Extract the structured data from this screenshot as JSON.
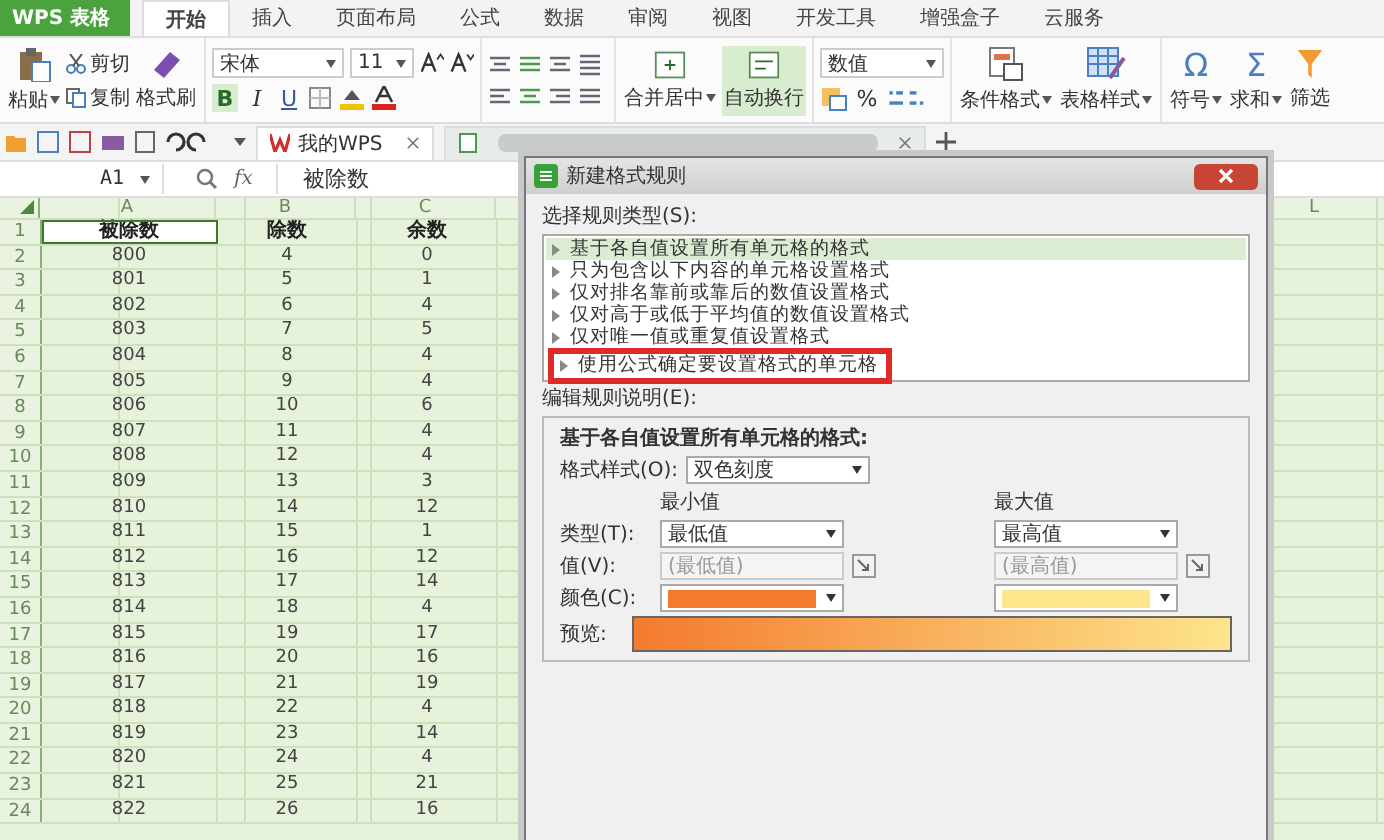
{
  "app_menu": {
    "label": "WPS 表格"
  },
  "tabs": [
    {
      "label": "开始",
      "selected": true
    },
    {
      "label": "插入",
      "selected": false
    },
    {
      "label": "页面布局",
      "selected": false
    },
    {
      "label": "公式",
      "selected": false
    },
    {
      "label": "数据",
      "selected": false
    },
    {
      "label": "审阅",
      "selected": false
    },
    {
      "label": "视图",
      "selected": false
    },
    {
      "label": "开发工具",
      "selected": false
    },
    {
      "label": "增强盒子",
      "selected": false
    },
    {
      "label": "云服务",
      "selected": false
    }
  ],
  "ribbon": {
    "paste": "粘贴",
    "cut": "剪切",
    "copy": "复制",
    "format_painter": "格式刷",
    "font": "宋体",
    "font_size": "11",
    "bold": "B",
    "italic": "I",
    "underline": "U",
    "merge_center": "合并居中",
    "wrap_text": {
      "label": "自动换行",
      "on": true
    },
    "number_format": "数值",
    "percent": "%",
    "conditional_format": "条件格式",
    "table_style": "表格样式",
    "symbol_glyph": "Ω",
    "symbol": "符号",
    "sum_glyph": "Σ",
    "sum": "求和",
    "filter": "筛选"
  },
  "doc_tabs": [
    {
      "label": "我的WPS"
    }
  ],
  "formula_bar": {
    "cell_ref": "A1",
    "fx": "fx",
    "content": "被除数"
  },
  "sheet": {
    "columns": [
      "A",
      "B",
      "C",
      "L"
    ],
    "rows": [
      {
        "num": "1",
        "kind": "header",
        "cells": [
          "被除数",
          "除数",
          "余数"
        ]
      },
      {
        "num": "2",
        "kind": "data",
        "cells": [
          "800",
          "4",
          "0"
        ]
      },
      {
        "num": "3",
        "kind": "data",
        "cells": [
          "801",
          "5",
          "1"
        ]
      },
      {
        "num": "4",
        "kind": "data",
        "cells": [
          "802",
          "6",
          "4"
        ]
      },
      {
        "num": "5",
        "kind": "data",
        "cells": [
          "803",
          "7",
          "5"
        ]
      },
      {
        "num": "6",
        "kind": "data",
        "cells": [
          "804",
          "8",
          "4"
        ]
      },
      {
        "num": "7",
        "kind": "data",
        "cells": [
          "805",
          "9",
          "4"
        ]
      },
      {
        "num": "8",
        "kind": "data",
        "cells": [
          "806",
          "10",
          "6"
        ]
      },
      {
        "num": "9",
        "kind": "data",
        "cells": [
          "807",
          "11",
          "4"
        ]
      },
      {
        "num": "10",
        "kind": "data",
        "cells": [
          "808",
          "12",
          "4"
        ]
      },
      {
        "num": "11",
        "kind": "data",
        "cells": [
          "809",
          "13",
          "3"
        ]
      },
      {
        "num": "12",
        "kind": "data",
        "cells": [
          "810",
          "14",
          "12"
        ]
      },
      {
        "num": "13",
        "kind": "data",
        "cells": [
          "811",
          "15",
          "1"
        ]
      },
      {
        "num": "14",
        "kind": "data",
        "cells": [
          "812",
          "16",
          "12"
        ]
      },
      {
        "num": "15",
        "kind": "data",
        "cells": [
          "813",
          "17",
          "14"
        ]
      },
      {
        "num": "16",
        "kind": "data",
        "cells": [
          "814",
          "18",
          "4"
        ]
      },
      {
        "num": "17",
        "kind": "data",
        "cells": [
          "815",
          "19",
          "17"
        ]
      },
      {
        "num": "18",
        "kind": "data",
        "cells": [
          "816",
          "20",
          "16"
        ]
      },
      {
        "num": "19",
        "kind": "data",
        "cells": [
          "817",
          "21",
          "19"
        ]
      },
      {
        "num": "20",
        "kind": "data",
        "cells": [
          "818",
          "22",
          "4"
        ]
      },
      {
        "num": "21",
        "kind": "data",
        "cells": [
          "819",
          "23",
          "14"
        ]
      },
      {
        "num": "22",
        "kind": "data",
        "cells": [
          "820",
          "24",
          "4"
        ]
      },
      {
        "num": "23",
        "kind": "data",
        "cells": [
          "821",
          "25",
          "21"
        ]
      },
      {
        "num": "24",
        "kind": "data",
        "cells": [
          "822",
          "26",
          "16"
        ]
      }
    ]
  },
  "dialog": {
    "title": "新建格式规则",
    "rule_type_label": "选择规则类型(S):",
    "rule_types": [
      {
        "label": "基于各自值设置所有单元格的格式",
        "selected": true,
        "annotated": false
      },
      {
        "label": "只为包含以下内容的单元格设置格式",
        "selected": false,
        "annotated": false
      },
      {
        "label": "仅对排名靠前或靠后的数值设置格式",
        "selected": false,
        "annotated": false
      },
      {
        "label": "仅对高于或低于平均值的数值设置格式",
        "selected": false,
        "annotated": false
      },
      {
        "label": "仅对唯一值或重复值设置格式",
        "selected": false,
        "annotated": false
      },
      {
        "label": "使用公式确定要设置格式的单元格",
        "selected": false,
        "annotated": true
      }
    ],
    "description_label": "编辑规则说明(E):",
    "group_title": "基于各自值设置所有单元格的格式:",
    "format_style_label": "格式样式(O):",
    "format_style": "双色刻度",
    "min_heading": "最小值",
    "max_heading": "最大值",
    "type_label": "类型(T):",
    "min_type": "最低值",
    "max_type": "最高值",
    "value_label": "值(V):",
    "min_value": "(最低值)",
    "max_value": "(最高值)",
    "color_label": "颜色(C):",
    "min_swatch": {
      "color": "#f47a2e"
    },
    "max_swatch": {
      "color": "#fde58c"
    },
    "preview_label": "预览:"
  }
}
